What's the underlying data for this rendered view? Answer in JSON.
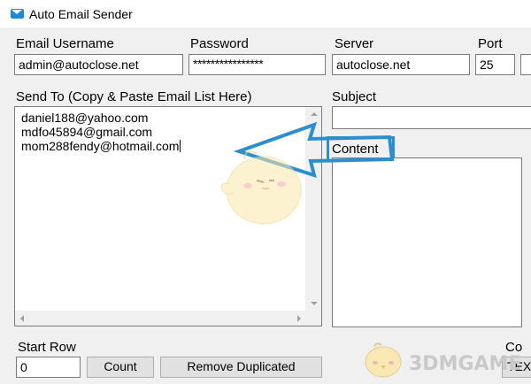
{
  "window": {
    "title": "Auto Email Sender",
    "icon": "mail-icon"
  },
  "fields": {
    "email_username_label": "Email Username",
    "email_username_value": "admin@autoclose.net",
    "password_label": "Password",
    "password_value": "****************",
    "server_label": "Server",
    "server_value": "autoclose.net",
    "port_label": "Port",
    "port_value": "25"
  },
  "send_to": {
    "label": "Send To (Copy & Paste Email List Here)",
    "emails": [
      "daniel188@yahoo.com",
      "mdfo45894@gmail.com",
      "mom288fendy@hotmail.com"
    ]
  },
  "subject": {
    "label": "Subject",
    "value": ""
  },
  "content": {
    "label": "Content",
    "value": ""
  },
  "bottom": {
    "start_row_label": "Start Row",
    "start_row_value": "0",
    "count_button": "Count",
    "remove_duplicated_button": "Remove Duplicated",
    "cut_label": "Co",
    "cut_value": "TEX"
  },
  "watermark": {
    "text": "3DMGAME"
  },
  "colors": {
    "annotation_blue": "#2a8fd0",
    "field_border": "#7a7a7a",
    "window_bg": "#f0f0f0"
  }
}
